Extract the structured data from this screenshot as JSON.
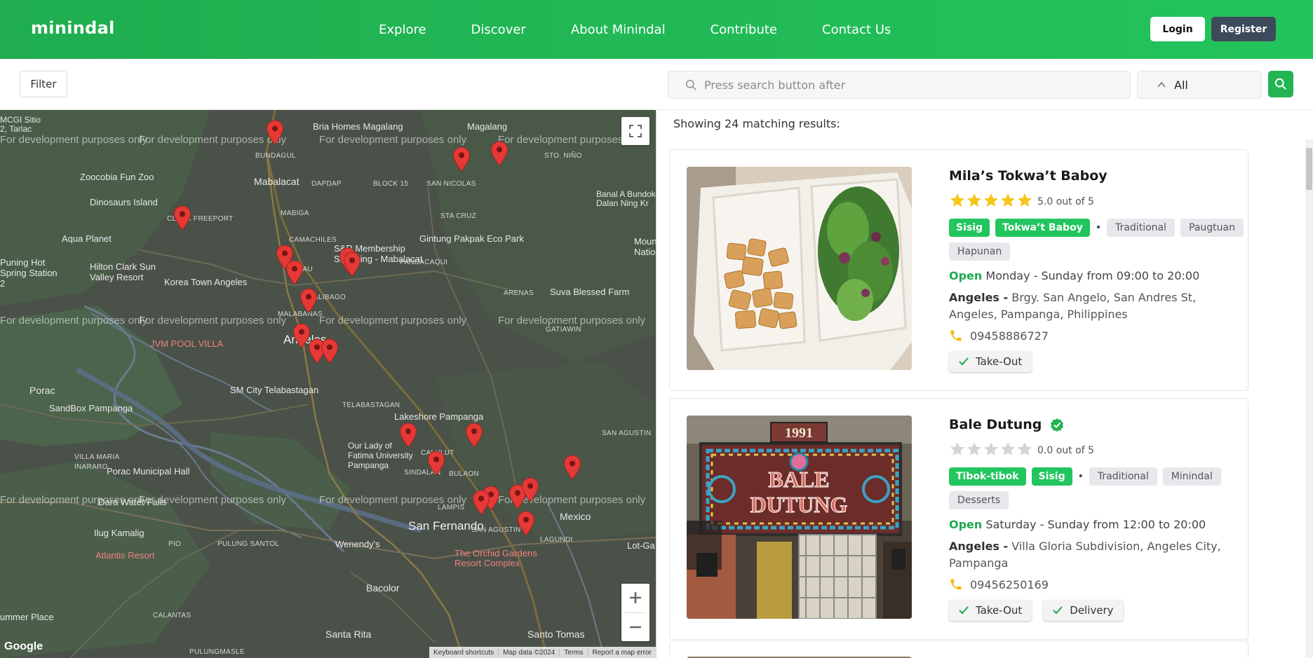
{
  "navbar": {
    "brand": "minindal",
    "links": [
      "Explore",
      "Discover",
      "About Minindal",
      "Contribute",
      "Contact Us"
    ],
    "login": "Login",
    "register": "Register"
  },
  "toolbar": {
    "filter": "Filter",
    "search_placeholder": "Press search button after",
    "type_selected": "All"
  },
  "map": {
    "dev_watermark": "For development purposes only",
    "labels": {
      "sitio": "MCGI Sitio 2, Tarlac",
      "bria": "Bria Homes Magalang",
      "magalang": "Magalang",
      "zoocobia": "Zoocobia Fun Zoo",
      "mabalacat": "Mabalacat",
      "bundagul": "BUNDAGUL",
      "dapdap": "DAPDAP",
      "block15": "BLOCK 15",
      "san_nicolas": "SAN NICOLAS",
      "sto_nino": "STO. NIÑO",
      "dinosaurs": "Dinosaurs Island",
      "banal": "Banal A Bundok Dalan Ning Kr",
      "mabiga": "MABIGA",
      "sta_cruz": "STA CRUZ",
      "gintung": "Gintung Pakpak Eco Park",
      "aqua": "Aqua Planet",
      "clark": "CLARK FREEPORT",
      "camachiles": "CAMACHILES",
      "sr": "S&R Membership Shopping - Mabalacat",
      "mount": "Mount Natio",
      "puning": "Puning Hot Spring Station 2",
      "hilton": "Hilton Clark Sun Valley Resort",
      "korea": "Korea Town Angeles",
      "dau": "DAU",
      "pandacaqui": "PANDACAQUI",
      "balibago": "BALIBAGO",
      "arenas": "ARENAS",
      "suva": "Suva Blessed Farm",
      "malabanas": "MALABANAS",
      "jvm": "JVM POOL VILLA",
      "angeles": "Angeles",
      "gatiawin": "GATIAWIN",
      "porac": "Porac",
      "sm": "SM City Telabastagan",
      "telabastagan": "TELABASTAGAN",
      "sandbox": "SandBox Pampanga",
      "lakeshore": "Lakeshore Pampanga",
      "san_agustin": "SAN AGUSTIN",
      "villa_maria": "VILLA MARIA",
      "inararo": "INARARO",
      "our_lady": "Our Lady of Fatima University Pampanga",
      "calulut": "CALULUT",
      "sindalan": "SINDALAN",
      "bulaon": "BULAON",
      "porac_hall": "Porac Municipal Hall",
      "dara": "Dara Water Falls",
      "lampis": "LAMPIS",
      "mexico": "Mexico",
      "san_fernando": "San Fernando",
      "ilug": "Ilug Kamalig",
      "pio": "PIO",
      "pulung_santol": "PULUNG SANTOL",
      "wenendy": "Wenendy's",
      "san_agustin2": "SAN AGUSTIN",
      "lagundi": "LAGUNDI",
      "lot": "Lot-Ga",
      "atlantis": "Atlantis Resort",
      "orchid": "The Orchid Gardens Resort Complex",
      "bacolor": "Bacolor",
      "calantas": "CALANTAS",
      "summer": "ummer Place",
      "santa_rita": "Santa Rita",
      "santo_tomas": "Santo Tomas",
      "pulungmasle": "PULUNGMASLE"
    },
    "google": "Google",
    "attribution": [
      "Keyboard shortcuts",
      "Map data ©2024",
      "Terms",
      "Report a map error"
    ]
  },
  "results": {
    "count_text": "Showing 24 matching results:",
    "items": [
      {
        "name": "Mila’s Tokwa’t Baboy",
        "rating_text": "5.0 out of 5",
        "stars": 5,
        "tags_primary": [
          "Sisig",
          "Tokwa’t Baboy"
        ],
        "tags_secondary": [
          "Traditional",
          "Paugtuan",
          "Hapunan"
        ],
        "dot": "•",
        "status": "Open",
        "days": "Monday - Sunday",
        "from_word": "from",
        "open_time": "09:00",
        "to_word": "to",
        "close_time": "20:00",
        "city": "Angeles -",
        "address": "Brgy. San Angelo, San Andres St, Angeles, Pampanga, Philippines",
        "phone": "09458886727",
        "services": [
          "Take-Out"
        ]
      },
      {
        "name": "Bale Dutung",
        "rating_text": "0.0 out of 5",
        "stars": 0,
        "tags_primary": [
          "Tibok-tibok",
          "Sisig"
        ],
        "tags_secondary": [
          "Traditional",
          "Minindal",
          "Desserts"
        ],
        "dot": "•",
        "status": "Open",
        "days": "Saturday - Sunday",
        "from_word": "from",
        "open_time": "12:00",
        "to_word": "to",
        "close_time": "20:00",
        "city": "Angeles -",
        "address": "Villa Gloria Subdivision, Angeles City, Pampanga",
        "phone": "09456250169",
        "services": [
          "Take-Out",
          "Delivery"
        ],
        "sign_year": "1991",
        "sign_words": [
          "BALE",
          "DUTUNG"
        ]
      }
    ]
  },
  "colors": {
    "brand_green": "#22b552",
    "tag_green": "#22c55e",
    "star_yellow": "#f5c518",
    "pin_red": "#e53935",
    "register_bg": "#3d4a5c"
  }
}
